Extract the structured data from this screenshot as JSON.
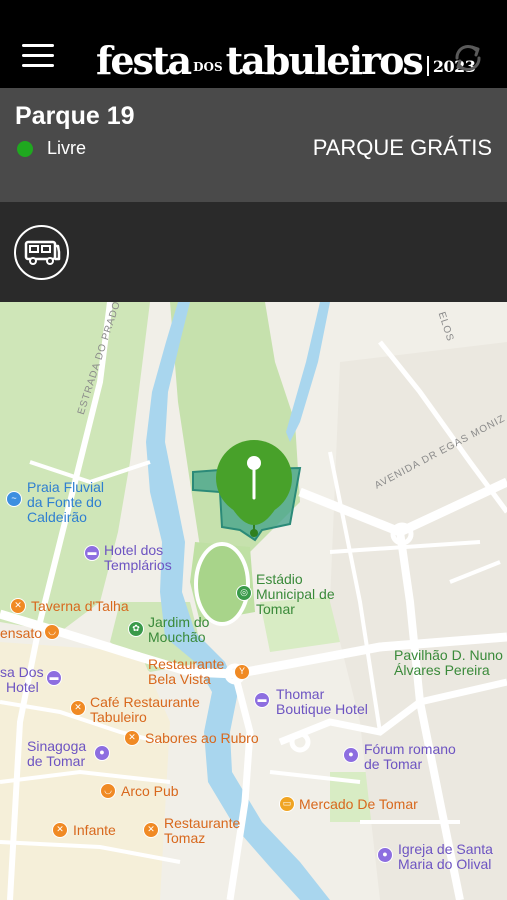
{
  "header": {
    "logo": {
      "word1": "festa",
      "word2": "DOS",
      "word3": "tabuleiros",
      "year": "2023"
    }
  },
  "park": {
    "name": "Parque 19",
    "status": "Livre",
    "status_color": "#1fa81f",
    "price": "PARQUE GRÁTIS"
  },
  "services": {
    "icon": "rv-icon"
  },
  "map": {
    "roads": [
      "ESTRADA DO PRADO",
      "AVENIDA DR EGAS MONIZ",
      "ELOS"
    ],
    "pois": [
      {
        "name": "Praia Fluvial da Fonte do Caldeirão",
        "lines": [
          "Praia Fluvial",
          "da Fonte do",
          "Caldeirão"
        ]
      },
      {
        "name": "Hotel dos Templários",
        "lines": [
          "Hotel dos",
          "Templários"
        ]
      },
      {
        "name": "Estádio Municipal de Tomar",
        "lines": [
          "Estádio",
          "Municipal de",
          "Tomar"
        ]
      },
      {
        "name": "Taverna d'Talha",
        "lines": [
          "Taverna d'Talha"
        ]
      },
      {
        "name": "Jardim do Mouchão",
        "lines": [
          "Jardim do",
          "Mouchão"
        ]
      },
      {
        "name": "ensato",
        "lines": [
          "ensato"
        ]
      },
      {
        "name": "Restaurante Bela Vista",
        "lines": [
          "Restaurante",
          "Bela Vista"
        ]
      },
      {
        "name": "Pavilhão D. Nuno Álvares Pereira",
        "lines": [
          "Pavilhão D. Nuno",
          "Álvares Pereira"
        ]
      },
      {
        "name": "sa Dos Hotel",
        "lines": [
          "sa Dos",
          "Hotel"
        ]
      },
      {
        "name": "Café Restaurante Tabuleiro",
        "lines": [
          "Café Restaurante",
          "Tabuleiro"
        ]
      },
      {
        "name": "Thomar Boutique Hotel",
        "lines": [
          "Thomar",
          "Boutique Hotel"
        ]
      },
      {
        "name": "Sinagoga de Tomar",
        "lines": [
          "Sinagoga",
          "de Tomar"
        ]
      },
      {
        "name": "Sabores ao Rubro",
        "lines": [
          "Sabores ao Rubro"
        ]
      },
      {
        "name": "Fórum romano de Tomar",
        "lines": [
          "Fórum romano",
          "de Tomar"
        ]
      },
      {
        "name": "Arco Pub",
        "lines": [
          "Arco Pub"
        ]
      },
      {
        "name": "Mercado De Tomar",
        "lines": [
          "Mercado De Tomar"
        ]
      },
      {
        "name": "Infante",
        "lines": [
          "Infante"
        ]
      },
      {
        "name": "Restaurante Tomaz",
        "lines": [
          "Restaurante",
          "Tomaz"
        ]
      },
      {
        "name": "Igreja de Santa Maria do Olival",
        "lines": [
          "Igreja de Santa",
          "Maria do Olival"
        ]
      }
    ]
  }
}
